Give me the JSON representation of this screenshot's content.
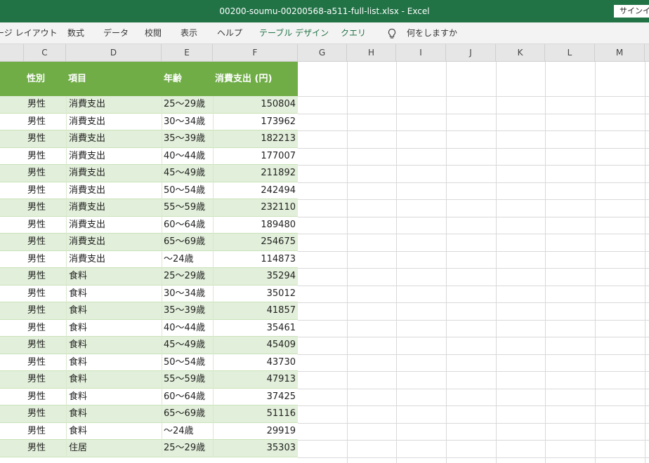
{
  "window": {
    "title": "00200-soumu-00200568-a511-full-list.xlsx  -  Excel",
    "signin_label": "サインイン"
  },
  "ribbon": {
    "tabs": [
      {
        "label": "ージ レイアウト",
        "contextual": false
      },
      {
        "label": "数式",
        "contextual": false
      },
      {
        "label": "データ",
        "contextual": false
      },
      {
        "label": "校閲",
        "contextual": false
      },
      {
        "label": "表示",
        "contextual": false
      },
      {
        "label": "ヘルプ",
        "contextual": false
      },
      {
        "label": "テーブル デザイン",
        "contextual": true
      },
      {
        "label": "クエリ",
        "contextual": true
      }
    ],
    "tell_me_icon": "lightbulb-icon",
    "tell_me_label": "何をしますか"
  },
  "columns": [
    "C",
    "D",
    "E",
    "F",
    "G",
    "H",
    "I",
    "J",
    "K",
    "L",
    "M"
  ],
  "table": {
    "headers": [
      "性別",
      "項目",
      "年齢",
      "消費支出 (円)"
    ],
    "rows": [
      [
        "男性",
        "消費支出",
        "25～29歳",
        "150804"
      ],
      [
        "男性",
        "消費支出",
        "30～34歳",
        "173962"
      ],
      [
        "男性",
        "消費支出",
        "35～39歳",
        "182213"
      ],
      [
        "男性",
        "消費支出",
        "40～44歳",
        "177007"
      ],
      [
        "男性",
        "消費支出",
        "45～49歳",
        "211892"
      ],
      [
        "男性",
        "消費支出",
        "50～54歳",
        "242494"
      ],
      [
        "男性",
        "消費支出",
        "55～59歳",
        "232110"
      ],
      [
        "男性",
        "消費支出",
        "60～64歳",
        "189480"
      ],
      [
        "男性",
        "消費支出",
        "65～69歳",
        "254675"
      ],
      [
        "男性",
        "消費支出",
        "～24歳",
        "114873"
      ],
      [
        "男性",
        "食料",
        "25～29歳",
        "35294"
      ],
      [
        "男性",
        "食料",
        "30～34歳",
        "35012"
      ],
      [
        "男性",
        "食料",
        "35～39歳",
        "41857"
      ],
      [
        "男性",
        "食料",
        "40～44歳",
        "35461"
      ],
      [
        "男性",
        "食料",
        "45～49歳",
        "45409"
      ],
      [
        "男性",
        "食料",
        "50～54歳",
        "43730"
      ],
      [
        "男性",
        "食料",
        "55～59歳",
        "47913"
      ],
      [
        "男性",
        "食料",
        "60～64歳",
        "37425"
      ],
      [
        "男性",
        "食料",
        "65～69歳",
        "51116"
      ],
      [
        "男性",
        "食料",
        "～24歳",
        "29919"
      ],
      [
        "男性",
        "住居",
        "25～29歳",
        "35303"
      ]
    ]
  }
}
